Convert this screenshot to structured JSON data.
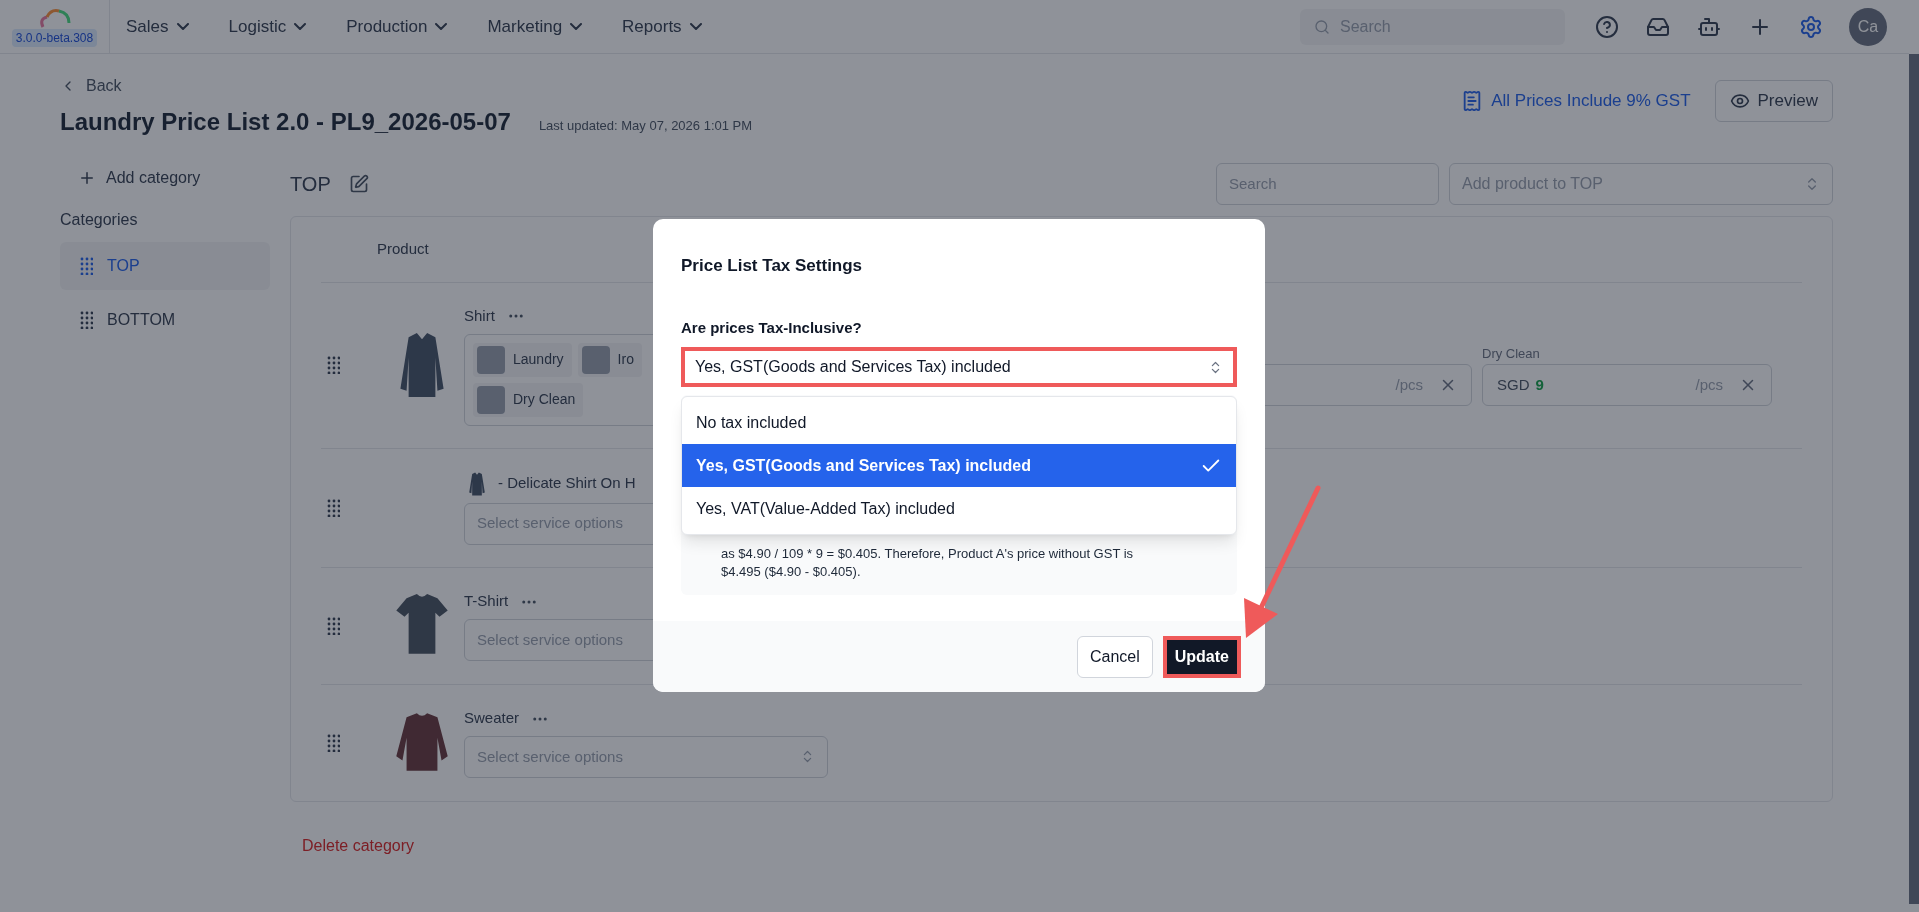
{
  "app": {
    "version": "3.0.0-beta.308"
  },
  "nav": {
    "items": [
      {
        "label": "Sales"
      },
      {
        "label": "Logistic"
      },
      {
        "label": "Production"
      },
      {
        "label": "Marketing"
      },
      {
        "label": "Reports"
      }
    ],
    "search": {
      "placeholder": "Search"
    },
    "avatar": "Ca"
  },
  "header": {
    "back": "Back",
    "title": "Laundry Price List 2.0 - PL9_2026-05-07",
    "last_updated": "Last updated: May 07, 2026 1:01 PM",
    "tax_note": "All Prices Include 9% GST",
    "preview": "Preview"
  },
  "sidebar": {
    "add": "Add category",
    "heading": "Categories",
    "items": [
      {
        "label": "TOP",
        "selected": true
      },
      {
        "label": "BOTTOM",
        "selected": false
      }
    ]
  },
  "category": {
    "title": "TOP",
    "search": {
      "placeholder": "Search"
    },
    "add_product": {
      "placeholder": "Add product to TOP"
    },
    "column": "Product",
    "products": [
      {
        "name": "Shirt",
        "kind": "tags",
        "photo": {
          "kind": "shirt",
          "inline": false
        },
        "tags": [
          "Laundry",
          "Iro",
          "Dry Clean"
        ],
        "prices": [
          {
            "unit": "/pcs"
          },
          {
            "label": "Dry Clean",
            "currency": "SGD",
            "amount": "9",
            "unit": "/pcs"
          }
        ]
      },
      {
        "name": "- Delicate Shirt On H",
        "kind": "select",
        "photo": {
          "kind": "shirt",
          "inline": true
        },
        "placeholder": "Select service options"
      },
      {
        "name": "T-Shirt",
        "kind": "select",
        "photo": {
          "kind": "tshirt",
          "inline": false
        },
        "placeholder": "Select service options"
      },
      {
        "name": "Sweater",
        "kind": "select",
        "photo": {
          "kind": "sweater",
          "inline": false
        },
        "placeholder": "Select service options"
      }
    ],
    "delete": "Delete category"
  },
  "dialog": {
    "title": "Price List Tax Settings",
    "question": "Are prices Tax-Inclusive?",
    "value": "Yes, GST(Goods and Services Tax) included",
    "options": [
      {
        "label": "No tax included",
        "selected": false
      },
      {
        "label": "Yes, GST(Goods and Services Tax) included",
        "selected": true
      },
      {
        "label": "Yes, VAT(Value-Added Tax) included",
        "selected": false
      }
    ],
    "info": [
      "as $4.90 / 109 * 9 = $0.405. Therefore, Product A's price without GST is",
      "$4.495 ($4.90 - $0.405)."
    ],
    "cancel": "Cancel",
    "update": "Update"
  }
}
